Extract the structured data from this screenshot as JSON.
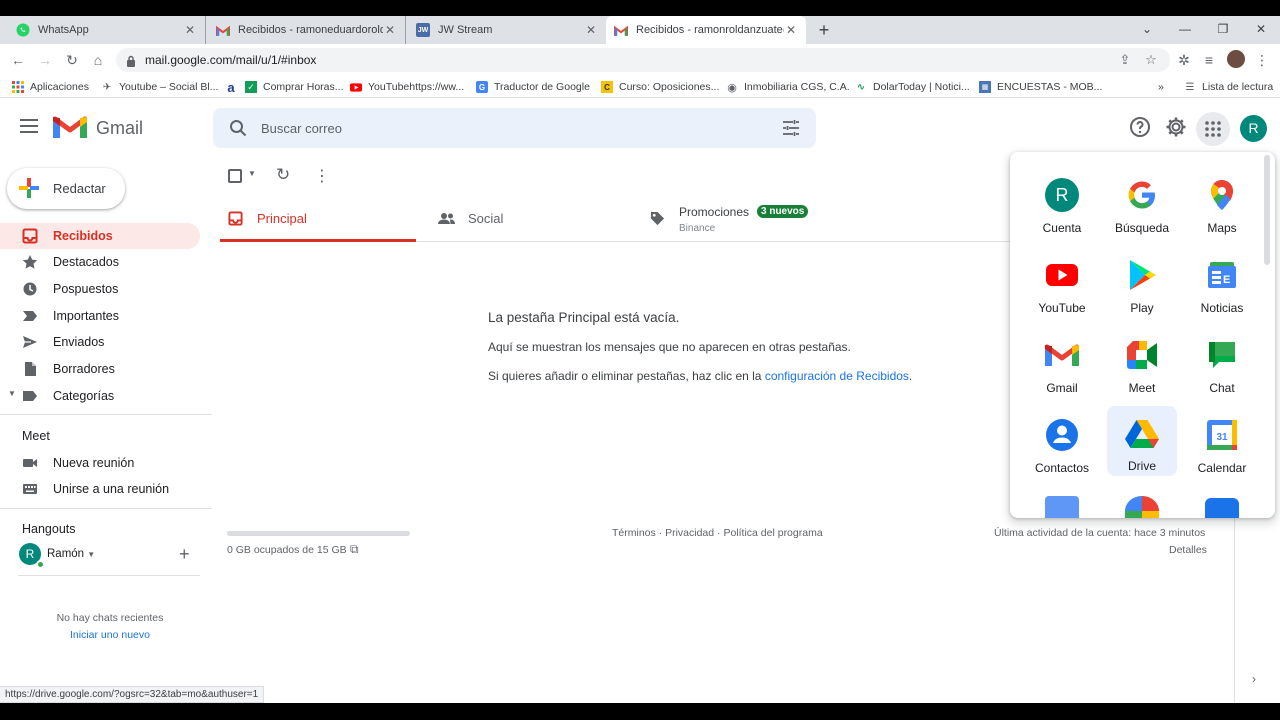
{
  "browser": {
    "tabs": [
      {
        "title": "WhatsApp"
      },
      {
        "title": "Recibidos - ramoneduardoroldan"
      },
      {
        "title": "JW Stream"
      },
      {
        "title": "Recibidos - ramonroldanzuate@"
      }
    ],
    "url": "mail.google.com/mail/u/1/#inbox",
    "bookmarks": [
      {
        "label": "Aplicaciones",
        "icon": "apps-grid-icon"
      },
      {
        "label": "Youtube – Social Bl...",
        "icon": "socialblade-icon"
      },
      {
        "label": "",
        "icon": "amazon-icon"
      },
      {
        "label": "Comprar Horas...",
        "icon": "checkbox-icon"
      },
      {
        "label": "YouTubehttps://ww...",
        "icon": "youtube-icon"
      },
      {
        "label": "Traductor de Google",
        "icon": "translate-icon"
      },
      {
        "label": "Curso: Oposiciones...",
        "icon": "course-icon"
      },
      {
        "label": "Inmobiliaria CGS, C.A.",
        "icon": "globe-icon"
      },
      {
        "label": "DolarToday | Notici...",
        "icon": "dolartoday-icon"
      },
      {
        "label": "ENCUESTAS - MOB...",
        "icon": "survey-icon"
      }
    ],
    "reading_list": "Lista de lectura",
    "status_url": "https://drive.google.com/?ogsrc=32&tab=mo&authuser=1"
  },
  "gmail": {
    "brand": "Gmail",
    "search_placeholder": "Buscar correo",
    "avatar_letter": "R",
    "compose_label": "Redactar",
    "nav": [
      {
        "label": "Recibidos",
        "icon": "inbox-icon"
      },
      {
        "label": "Destacados",
        "icon": "star-icon"
      },
      {
        "label": "Pospuestos",
        "icon": "clock-icon"
      },
      {
        "label": "Importantes",
        "icon": "important-icon"
      },
      {
        "label": "Enviados",
        "icon": "send-icon"
      },
      {
        "label": "Borradores",
        "icon": "draft-icon"
      },
      {
        "label": "Categorías",
        "icon": "label-icon"
      }
    ],
    "meet": {
      "title": "Meet",
      "items": [
        {
          "label": "Nueva reunión",
          "icon": "video-icon"
        },
        {
          "label": "Unirse a una reunión",
          "icon": "keyboard-icon"
        }
      ]
    },
    "hangouts": {
      "title": "Hangouts",
      "user": "Ramón",
      "avatar_letter": "R",
      "no_chats": "No hay chats recientes",
      "start_new": "Iniciar uno nuevo"
    },
    "category_tabs": [
      {
        "label": "Principal",
        "icon": "inbox-icon"
      },
      {
        "label": "Social",
        "icon": "people-icon"
      },
      {
        "label": "Promociones",
        "icon": "tag-icon",
        "badge": "3 nuevos",
        "sub": "Binance"
      }
    ],
    "empty": {
      "title": "La pestaña Principal está vacía.",
      "line1": "Aquí se muestran los mensajes que no aparecen en otras pestañas.",
      "line2_prefix": "Si quieres añadir o eliminar pestañas, haz clic en la ",
      "line2_link": "configuración de Recibidos",
      "line2_suffix": "."
    },
    "footer": {
      "storage": "0 GB ocupados de 15 GB",
      "storage_used_fraction": 0.0,
      "links": "Términos · Privacidad · Política del programa",
      "activity": "Última actividad de la cuenta: hace 3 minutos",
      "details": "Detalles"
    }
  },
  "apps_panel": {
    "items": [
      {
        "label": "Cuenta",
        "icon": "account-icon",
        "letter": "R"
      },
      {
        "label": "Búsqueda",
        "icon": "google-search-icon"
      },
      {
        "label": "Maps",
        "icon": "maps-icon"
      },
      {
        "label": "YouTube",
        "icon": "youtube-icon"
      },
      {
        "label": "Play",
        "icon": "play-icon"
      },
      {
        "label": "Noticias",
        "icon": "news-icon"
      },
      {
        "label": "Gmail",
        "icon": "gmail-icon"
      },
      {
        "label": "Meet",
        "icon": "meet-icon"
      },
      {
        "label": "Chat",
        "icon": "chat-icon"
      },
      {
        "label": "Contactos",
        "icon": "contacts-icon"
      },
      {
        "label": "Drive",
        "icon": "drive-icon"
      },
      {
        "label": "Calendar",
        "icon": "calendar-icon",
        "day": "31"
      }
    ]
  },
  "colors": {
    "gmail_red": "#d93025",
    "selected_bg": "#fce8e6",
    "badge_green": "#188038",
    "link_blue": "#1a73e8",
    "avatar_teal": "#00897b"
  }
}
